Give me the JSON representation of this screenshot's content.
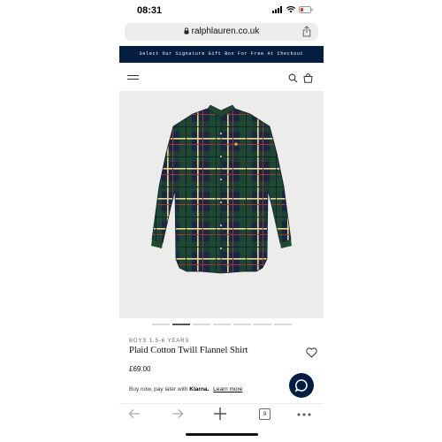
{
  "status_bar": {
    "time": "08:31"
  },
  "browser": {
    "url": "ralphlauren.co.uk",
    "tab_count": "9"
  },
  "promo_banner": {
    "text": "Select Our Signature Gift Box For Free At Checkout"
  },
  "product": {
    "age_range": "BOYS 1.5-6 YEARS",
    "name": "Plaid Cotton Twill Flannel Shirt",
    "price": "£69.00",
    "image_count": 7,
    "active_image": 2
  },
  "payment": {
    "text": "Buy now, pay later with",
    "provider": "Klarna.",
    "link": "Learn more"
  },
  "colors": {
    "navy_accent": "#041e42",
    "image_background": "#ececea",
    "shirt_green": "#1d4a2e",
    "shirt_navy": "#1b2546"
  },
  "icons": {
    "header": [
      "menu-icon",
      "search-icon",
      "shopping-bag-icon"
    ],
    "toolbar": [
      "back-arrow-icon",
      "forward-arrow-icon",
      "add-icon",
      "tabs-icon",
      "more-icon"
    ]
  }
}
